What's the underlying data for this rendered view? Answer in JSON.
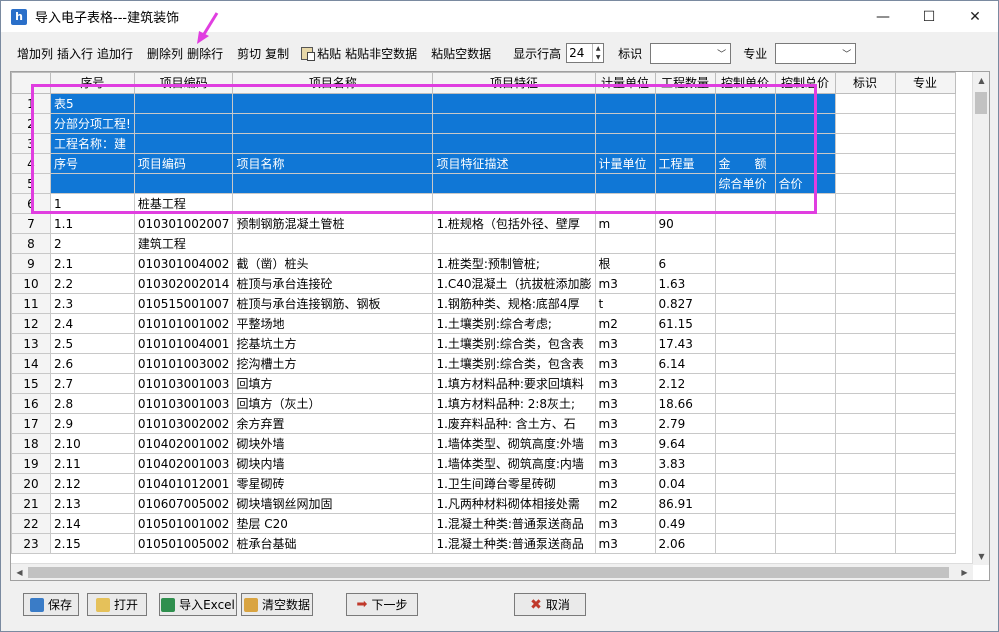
{
  "window": {
    "title": "导入电子表格---建筑装饰",
    "min": "—",
    "max": "☐",
    "close": "✕"
  },
  "toolbar": {
    "add_col": "增加列",
    "insert_row": "插入行",
    "append_row": "追加行",
    "delete_col": "删除列",
    "delete_row": "删除行",
    "cut": "剪切",
    "copy": "复制",
    "paste": "粘贴",
    "paste_nonempty": "粘贴非空数据",
    "paste_empty": "粘贴空数据",
    "row_height_label": "显示行高",
    "row_height_value": "24",
    "mark_label": "标识",
    "major_label": "专业"
  },
  "grid": {
    "headers": [
      "",
      "序号",
      "项目编码",
      "项目名称",
      "项目特征",
      "计量单位",
      "工程数量",
      "控制单价",
      "控制总价",
      "标识",
      "专业"
    ],
    "rows": [
      {
        "n": "1",
        "c": [
          "表5",
          "",
          "",
          "",
          "",
          "",
          "",
          "",
          "",
          ""
        ]
      },
      {
        "n": "2",
        "c": [
          "分部分项工程!",
          "",
          "",
          "",
          "",
          "",
          "",
          "",
          "",
          ""
        ]
      },
      {
        "n": "3",
        "c": [
          "工程名称：建",
          "",
          "",
          "",
          "",
          "",
          "",
          "",
          "",
          ""
        ]
      },
      {
        "n": "4",
        "c": [
          "序号",
          "项目编码",
          "项目名称",
          "项目特征描述",
          "计量单位",
          "工程量",
          "金　　额",
          "",
          "",
          ""
        ]
      },
      {
        "n": "5",
        "c": [
          "",
          "",
          "",
          "",
          "",
          "",
          "综合单价",
          "合价",
          "",
          ""
        ]
      },
      {
        "n": "6",
        "c": [
          "1",
          "桩基工程",
          "",
          "",
          "",
          "",
          "",
          "",
          "",
          ""
        ]
      },
      {
        "n": "7",
        "c": [
          "1.1",
          "010301002007",
          "预制钢筋混凝土管桩",
          "1.桩规格（包括外径、壁厚",
          "m",
          "90",
          "",
          "",
          "",
          ""
        ]
      },
      {
        "n": "8",
        "c": [
          "2",
          "建筑工程",
          "",
          "",
          "",
          "",
          "",
          "",
          "",
          ""
        ]
      },
      {
        "n": "9",
        "c": [
          "2.1",
          "010301004002",
          "截（凿）桩头",
          "1.桩类型:预制管桩;",
          "根",
          "6",
          "",
          "",
          "",
          ""
        ]
      },
      {
        "n": "10",
        "c": [
          "2.2",
          "010302002014",
          "桩顶与承台连接砼",
          "1.C40混凝土（抗拔桩添加膨",
          "m3",
          "1.63",
          "",
          "",
          "",
          ""
        ]
      },
      {
        "n": "11",
        "c": [
          "2.3",
          "010515001007",
          "桩顶与承台连接钢筋、钢板",
          "1.钢筋种类、规格:底部4厚",
          "t",
          "0.827",
          "",
          "",
          "",
          ""
        ]
      },
      {
        "n": "12",
        "c": [
          "2.4",
          "010101001002",
          "平整场地",
          "1.土壤类别:综合考虑;",
          "m2",
          "61.15",
          "",
          "",
          "",
          ""
        ]
      },
      {
        "n": "13",
        "c": [
          "2.5",
          "010101004001",
          "挖基坑土方",
          "1.土壤类别:综合类，包含表",
          "m3",
          "17.43",
          "",
          "",
          "",
          ""
        ]
      },
      {
        "n": "14",
        "c": [
          "2.6",
          "010101003002",
          "挖沟槽土方",
          "1.土壤类别:综合类，包含表",
          "m3",
          "6.14",
          "",
          "",
          "",
          ""
        ]
      },
      {
        "n": "15",
        "c": [
          "2.7",
          "010103001003",
          "回填方",
          "1.填方材料品种:要求回填料",
          "m3",
          "2.12",
          "",
          "",
          "",
          ""
        ]
      },
      {
        "n": "16",
        "c": [
          "2.8",
          "010103001003",
          "回填方（灰土）",
          "1.填方材料品种: 2:8灰土;",
          "m3",
          "18.66",
          "",
          "",
          "",
          ""
        ]
      },
      {
        "n": "17",
        "c": [
          "2.9",
          "010103002002",
          "余方弃置",
          "1.废弃料品种: 含土方、石",
          "m3",
          "2.79",
          "",
          "",
          "",
          ""
        ]
      },
      {
        "n": "18",
        "c": [
          "2.10",
          "010402001002",
          "砌块外墙",
          "1.墙体类型、砌筑高度:外墙",
          "m3",
          "9.64",
          "",
          "",
          "",
          ""
        ]
      },
      {
        "n": "19",
        "c": [
          "2.11",
          "010402001003",
          "砌块内墙",
          "1.墙体类型、砌筑高度:内墙",
          "m3",
          "3.83",
          "",
          "",
          "",
          ""
        ]
      },
      {
        "n": "20",
        "c": [
          "2.12",
          "010401012001",
          "零星砌砖",
          "1.卫生间蹲台零星砖砌",
          "m3",
          "0.04",
          "",
          "",
          "",
          ""
        ]
      },
      {
        "n": "21",
        "c": [
          "2.13",
          "010607005002",
          "砌块墙钢丝网加固",
          "1.凡两种材料砌体相接处需",
          "m2",
          "86.91",
          "",
          "",
          "",
          ""
        ]
      },
      {
        "n": "22",
        "c": [
          "2.14",
          "010501001002",
          "垫层 C20",
          "1.混凝土种类:普通泵送商品",
          "m3",
          "0.49",
          "",
          "",
          "",
          ""
        ]
      },
      {
        "n": "23",
        "c": [
          "2.15",
          "010501005002",
          "桩承台基础",
          "1.混凝土种类:普通泵送商品",
          "m3",
          "2.06",
          "",
          "",
          "",
          ""
        ]
      }
    ]
  },
  "buttons": {
    "save": "保存",
    "open": "打开",
    "import_excel": "导入Excel",
    "clear": "清空数据",
    "next": "下一步",
    "cancel": "取消"
  },
  "colors": {
    "selection": "#1077d6",
    "annotation": "#e03ee0"
  }
}
